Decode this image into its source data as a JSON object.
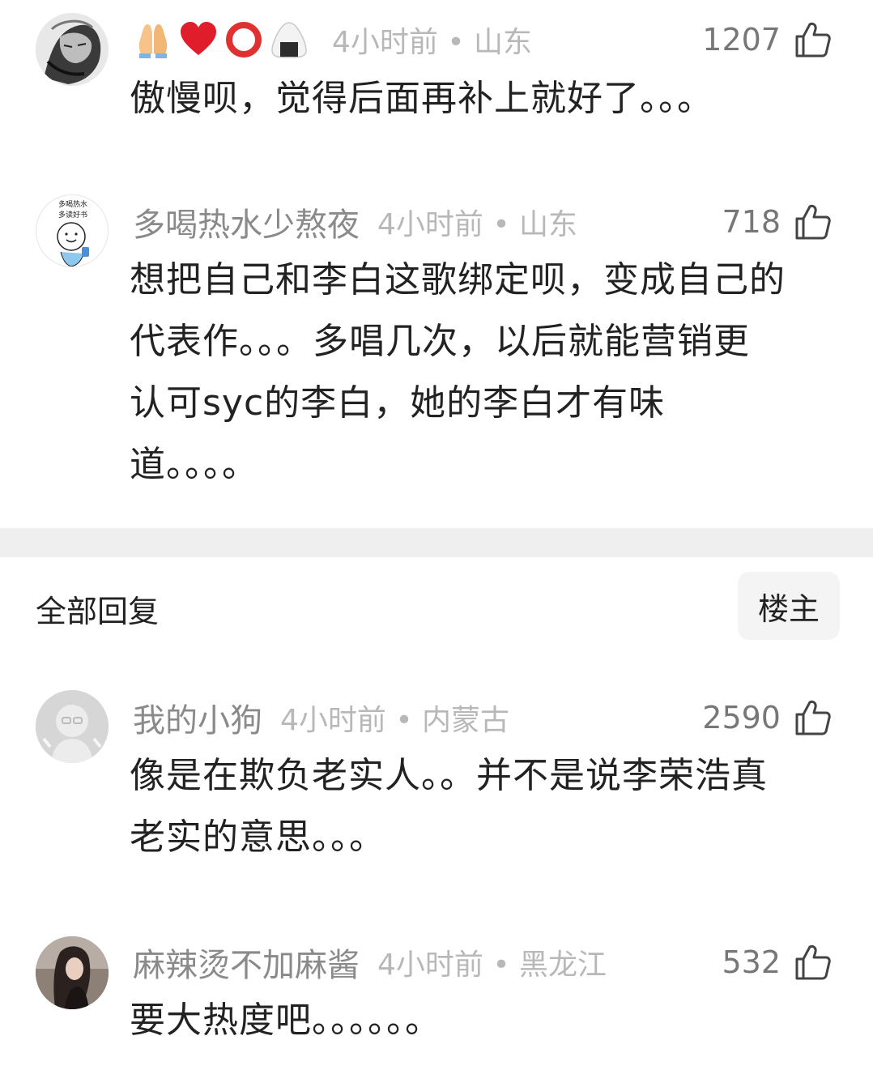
{
  "comments": [
    {
      "username_icons": [
        "folded-hands-icon",
        "red-heart-icon",
        "red-circle-icon",
        "rice-ball-icon"
      ],
      "username": "",
      "time": "4小时前",
      "location": "山东",
      "time_location": "4小时前 • 山东",
      "likes": "1207",
      "text": "傲慢呗，觉得后面再补上就好了。。。"
    },
    {
      "username": "多喝热水少熬夜",
      "avatar_text_line1": "多喝热水",
      "avatar_text_line2": "多读好书",
      "time_location": "4小时前 • 山东",
      "likes": "718",
      "text_lines": [
        "想把自己和李白这歌绑定呗，变成自己的",
        "代表作。。。多唱几次，以后就能营销更",
        "认可syc的李白，她的李白才有味",
        "道。。。。"
      ]
    }
  ],
  "section": {
    "title": "全部回复",
    "op_button": "楼主"
  },
  "replies": [
    {
      "username": "我的小狗",
      "time_location": "4小时前 • 内蒙古",
      "likes": "2590",
      "text_lines": [
        "像是在欺负老实人。。并不是说李荣浩真",
        "老实的意思。。。"
      ]
    },
    {
      "username": "麻辣烫不加麻酱",
      "time_location": "4小时前 • 黑龙江",
      "likes": "532",
      "text": "要大热度吧。。。。。。"
    }
  ],
  "colors": {
    "username": "#8a8a8a",
    "meta": "#b8b8b8",
    "like_count": "#777777",
    "body_text": "#222222",
    "divider": "#efefef"
  }
}
